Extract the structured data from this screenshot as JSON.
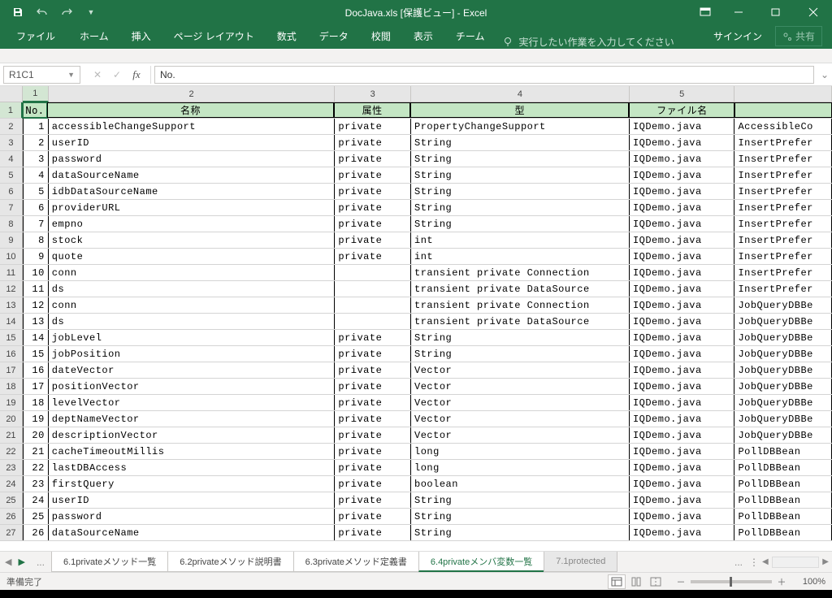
{
  "titlebar": {
    "title": "DocJava.xls  [保護ビュー] - Excel"
  },
  "ribbon": {
    "tabs": [
      "ファイル",
      "ホーム",
      "挿入",
      "ページ レイアウト",
      "数式",
      "データ",
      "校閲",
      "表示",
      "チーム"
    ],
    "tell_me": "実行したい作業を入力してください",
    "signin": "サインイン",
    "share": "共有"
  },
  "formula": {
    "name_box": "R1C1",
    "value": "No."
  },
  "columns": [
    "1",
    "2",
    "3",
    "4",
    "5"
  ],
  "headers": {
    "no": "No.",
    "name": "名称",
    "attr": "属性",
    "type": "型",
    "file": "ファイル名"
  },
  "rows": [
    {
      "n": "1",
      "name": "accessibleChangeSupport",
      "attr": "private",
      "type": "PropertyChangeSupport",
      "file": "IQDemo.java",
      "cls": "AccessibleCo"
    },
    {
      "n": "2",
      "name": "userID",
      "attr": "private",
      "type": "String",
      "file": "IQDemo.java",
      "cls": "InsertPrefer"
    },
    {
      "n": "3",
      "name": "password",
      "attr": "private",
      "type": "String",
      "file": "IQDemo.java",
      "cls": "InsertPrefer"
    },
    {
      "n": "4",
      "name": "dataSourceName",
      "attr": "private",
      "type": "String",
      "file": "IQDemo.java",
      "cls": "InsertPrefer"
    },
    {
      "n": "5",
      "name": "idbDataSourceName",
      "attr": "private",
      "type": "String",
      "file": "IQDemo.java",
      "cls": "InsertPrefer"
    },
    {
      "n": "6",
      "name": "providerURL",
      "attr": "private",
      "type": "String",
      "file": "IQDemo.java",
      "cls": "InsertPrefer"
    },
    {
      "n": "7",
      "name": "empno",
      "attr": "private",
      "type": "String",
      "file": "IQDemo.java",
      "cls": "InsertPrefer"
    },
    {
      "n": "8",
      "name": "stock",
      "attr": "private",
      "type": "int",
      "file": "IQDemo.java",
      "cls": "InsertPrefer"
    },
    {
      "n": "9",
      "name": "quote",
      "attr": "private",
      "type": "int",
      "file": "IQDemo.java",
      "cls": "InsertPrefer"
    },
    {
      "n": "10",
      "name": "conn",
      "attr": "",
      "type": "transient private Connection",
      "file": "IQDemo.java",
      "cls": "InsertPrefer"
    },
    {
      "n": "11",
      "name": "ds",
      "attr": "",
      "type": "transient private DataSource",
      "file": "IQDemo.java",
      "cls": "InsertPrefer"
    },
    {
      "n": "12",
      "name": "conn",
      "attr": "",
      "type": "transient private Connection",
      "file": "IQDemo.java",
      "cls": "JobQueryDBBe"
    },
    {
      "n": "13",
      "name": "ds",
      "attr": "",
      "type": "transient private DataSource",
      "file": "IQDemo.java",
      "cls": "JobQueryDBBe"
    },
    {
      "n": "14",
      "name": "jobLevel",
      "attr": "private",
      "type": "String",
      "file": "IQDemo.java",
      "cls": "JobQueryDBBe"
    },
    {
      "n": "15",
      "name": "jobPosition",
      "attr": "private",
      "type": "String",
      "file": "IQDemo.java",
      "cls": "JobQueryDBBe"
    },
    {
      "n": "16",
      "name": "dateVector",
      "attr": "private",
      "type": "Vector",
      "file": "IQDemo.java",
      "cls": "JobQueryDBBe"
    },
    {
      "n": "17",
      "name": "positionVector",
      "attr": "private",
      "type": "Vector",
      "file": "IQDemo.java",
      "cls": "JobQueryDBBe"
    },
    {
      "n": "18",
      "name": "levelVector",
      "attr": "private",
      "type": "Vector",
      "file": "IQDemo.java",
      "cls": "JobQueryDBBe"
    },
    {
      "n": "19",
      "name": "deptNameVector",
      "attr": "private",
      "type": "Vector",
      "file": "IQDemo.java",
      "cls": "JobQueryDBBe"
    },
    {
      "n": "20",
      "name": "descriptionVector",
      "attr": "private",
      "type": "Vector",
      "file": "IQDemo.java",
      "cls": "JobQueryDBBe"
    },
    {
      "n": "21",
      "name": "cacheTimeoutMillis",
      "attr": "private",
      "type": "long",
      "file": "IQDemo.java",
      "cls": "PollDBBean"
    },
    {
      "n": "22",
      "name": "lastDBAccess",
      "attr": "private",
      "type": "long",
      "file": "IQDemo.java",
      "cls": "PollDBBean"
    },
    {
      "n": "23",
      "name": "firstQuery",
      "attr": "private",
      "type": "boolean",
      "file": "IQDemo.java",
      "cls": "PollDBBean"
    },
    {
      "n": "24",
      "name": "userID",
      "attr": "private",
      "type": "String",
      "file": "IQDemo.java",
      "cls": "PollDBBean"
    },
    {
      "n": "25",
      "name": "password",
      "attr": "private",
      "type": "String",
      "file": "IQDemo.java",
      "cls": "PollDBBean"
    },
    {
      "n": "26",
      "name": "dataSourceName",
      "attr": "private",
      "type": "String",
      "file": "IQDemo.java",
      "cls": "PollDBBean"
    }
  ],
  "sheets": {
    "tabs": [
      "6.1privateメソッド一覧",
      "6.2privateメソッド説明書",
      "6.3privateメソッド定義書",
      "6.4privateメンバ変数一覧",
      "7.1protected"
    ],
    "active_index": 3
  },
  "status": {
    "ready": "準備完了",
    "zoom": "100%"
  }
}
